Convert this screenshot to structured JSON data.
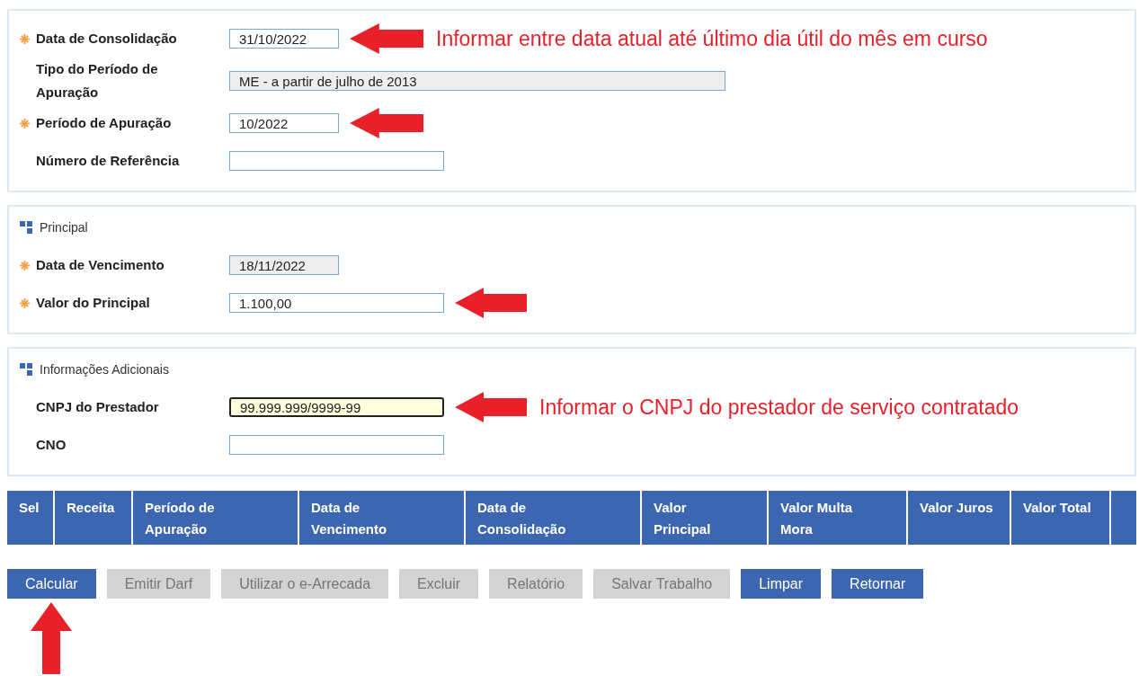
{
  "sections": [
    {
      "fields": [
        {
          "label": "Data de Consolidação",
          "required": true,
          "kind": "date",
          "value": "31/10/2022",
          "readonly": false,
          "focused": false,
          "arrow": true,
          "annotation": "Informar entre data atual até último dia útil do mês em curso"
        },
        {
          "label": "Tipo do Período de Apuração",
          "required": false,
          "kind": "combo",
          "value": "ME - a partir de julho de 2013",
          "readonly": true,
          "focused": false,
          "arrow": false
        },
        {
          "label": "Período de Apuração",
          "required": true,
          "kind": "date",
          "value": "10/2022",
          "readonly": false,
          "focused": false,
          "arrow": true
        },
        {
          "label": "Número de Referência",
          "required": false,
          "kind": "text",
          "readonly": false,
          "focused": false,
          "arrow": false
        }
      ]
    },
    {
      "title": "Principal",
      "fields": [
        {
          "label": "Data de Vencimento",
          "required": true,
          "kind": "date",
          "value": "18/11/2022",
          "readonly": true,
          "focused": false,
          "arrow": false
        },
        {
          "label": "Valor do Principal",
          "required": true,
          "kind": "text",
          "value": "1.100,00",
          "readonly": false,
          "focused": false,
          "arrow": true
        }
      ]
    },
    {
      "title": "Informações Adicionais",
      "fields": [
        {
          "label": "CNPJ do Prestador",
          "required": false,
          "kind": "text",
          "value": "99.999.999/9999-99",
          "readonly": false,
          "focused": true,
          "arrow": true,
          "annotation": "Informar o CNPJ do prestador de serviço contratado"
        },
        {
          "label": "CNO",
          "required": false,
          "kind": "text",
          "readonly": false,
          "focused": false,
          "arrow": false
        }
      ]
    }
  ],
  "table": {
    "columns": [
      "Sel",
      "Receita",
      "Período de Apuração",
      "Data de Vencimento",
      "Data de Consolidação",
      "Valor Principal",
      "Valor Multa Mora",
      "Valor Juros",
      "Valor Total"
    ]
  },
  "buttons": [
    {
      "label": "Calcular",
      "disabled": false,
      "arrow": true
    },
    {
      "label": "Emitir Darf",
      "disabled": true,
      "arrow": false
    },
    {
      "label": "Utilizar o e-Arrecada",
      "disabled": true,
      "arrow": false
    },
    {
      "label": "Excluir",
      "disabled": true,
      "arrow": false
    },
    {
      "label": "Relatório",
      "disabled": true,
      "arrow": false
    },
    {
      "label": "Salvar Trabalho",
      "disabled": true,
      "arrow": false
    },
    {
      "label": "Limpar",
      "disabled": false,
      "arrow": false
    },
    {
      "label": "Retornar",
      "disabled": false,
      "arrow": false
    }
  ]
}
